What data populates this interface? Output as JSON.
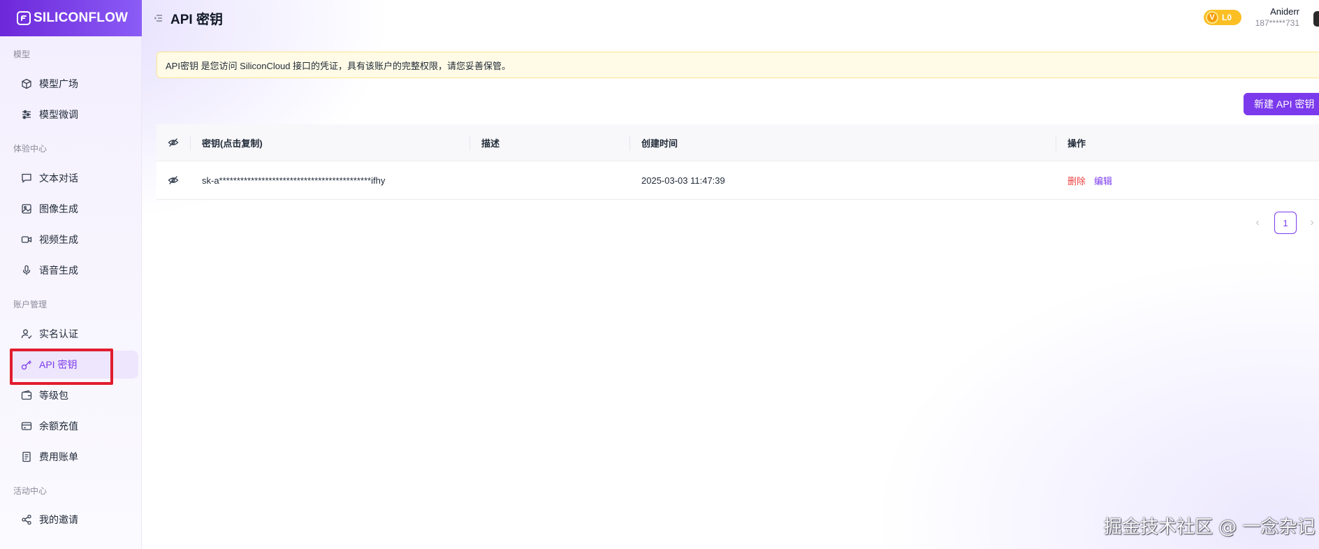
{
  "app": {
    "logo_text": "SILICONFLOW",
    "page_title": "API 密钥"
  },
  "sidebar": {
    "sections": [
      {
        "label": "模型"
      },
      {
        "label": "体验中心"
      },
      {
        "label": "账户管理"
      },
      {
        "label": "活动中心"
      }
    ],
    "items": [
      {
        "label": "模型广场",
        "icon": "cube-icon"
      },
      {
        "label": "模型微调",
        "icon": "sliders-icon"
      },
      {
        "label": "文本对话",
        "icon": "chat-icon"
      },
      {
        "label": "图像生成",
        "icon": "image-icon"
      },
      {
        "label": "视频生成",
        "icon": "video-icon"
      },
      {
        "label": "语音生成",
        "icon": "microphone-icon"
      },
      {
        "label": "实名认证",
        "icon": "user-check-icon"
      },
      {
        "label": "API 密钥",
        "icon": "key-icon",
        "active": true
      },
      {
        "label": "等级包",
        "icon": "wallet-icon"
      },
      {
        "label": "余额充值",
        "icon": "credit-card-icon"
      },
      {
        "label": "费用账单",
        "icon": "receipt-icon"
      },
      {
        "label": "我的邀请",
        "icon": "share-icon"
      }
    ]
  },
  "user": {
    "level": "L0",
    "level_icon": "V",
    "name": "Aniderr",
    "phone": "187*****731"
  },
  "notice": {
    "text": "API密钥 是您访问 SiliconCloud 接口的凭证，具有该账户的完整权限，请您妥善保管。"
  },
  "actions": {
    "new_key": "新建 API 密钥"
  },
  "table": {
    "headers": {
      "key": "密钥(点击复制)",
      "description": "描述",
      "created": "创建时间",
      "actions": "操作"
    },
    "rows": [
      {
        "key": "sk-a*******************************************ifhy",
        "description": "",
        "created": "2025-03-03 11:47:39",
        "delete": "删除",
        "edit": "编辑"
      }
    ]
  },
  "pagination": {
    "current": "1",
    "prev": "‹",
    "next": "›"
  },
  "watermark": "掘金技术社区 @ 一念杂记",
  "colors": {
    "brand": "#7c3aed",
    "danger": "#ef4444",
    "notice_bg": "#fffbe6",
    "highlight": "#e11d2e"
  }
}
